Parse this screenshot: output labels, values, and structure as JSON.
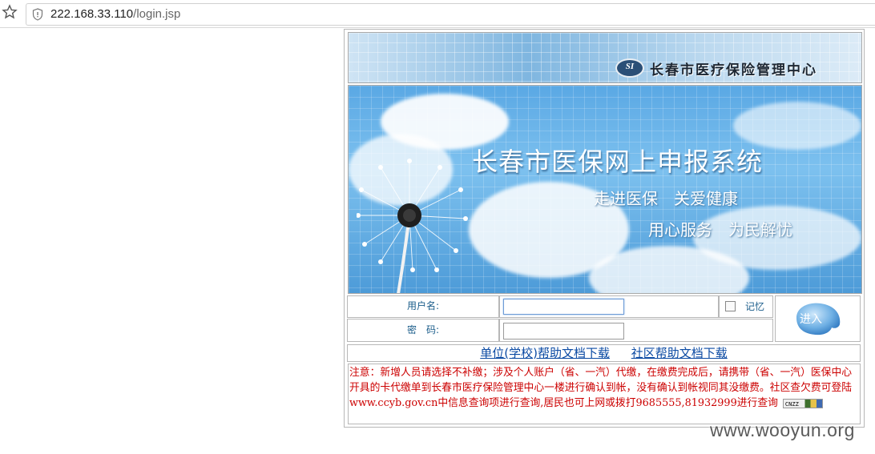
{
  "browser": {
    "url_host": "222.168.33.110",
    "url_path": "/login.jsp"
  },
  "header": {
    "logo_text": "SI",
    "title": "长春市医疗保险管理中心"
  },
  "banner": {
    "title": "长春市医保网上申报系统",
    "slogan_1": "走进医保　关爱健康",
    "slogan_2": "用心服务　为民解忧"
  },
  "form": {
    "username_label": "用户名:",
    "password_label": "密　码:",
    "username_value": "",
    "password_value": "",
    "remember_label": "记忆",
    "enter_label": "进入"
  },
  "links": {
    "unit_help": "单位(学校)帮助文档下载",
    "community_help": "社区帮助文档下载"
  },
  "notice": {
    "text": "注意：新增人员请选择不补缴；涉及个人账户（省、一汽）代缴，在缴费完成后，请携带（省、一汽）医保中心开具的卡代缴单到长春市医疗保险管理中心一楼进行确认到帐，没有确认到帐视同其没缴费。社区查欠费可登陆www.ccyb.gov.cn中信息查询项进行查询,居民也可上网或拨打9685555,81932999进行查询",
    "badge": "CNZZ"
  },
  "watermark": "www.wooyun.org",
  "colors": {
    "notice_red": "#cc0000",
    "link_blue": "#0b4aa3",
    "label_teal": "#1a5c8a"
  }
}
